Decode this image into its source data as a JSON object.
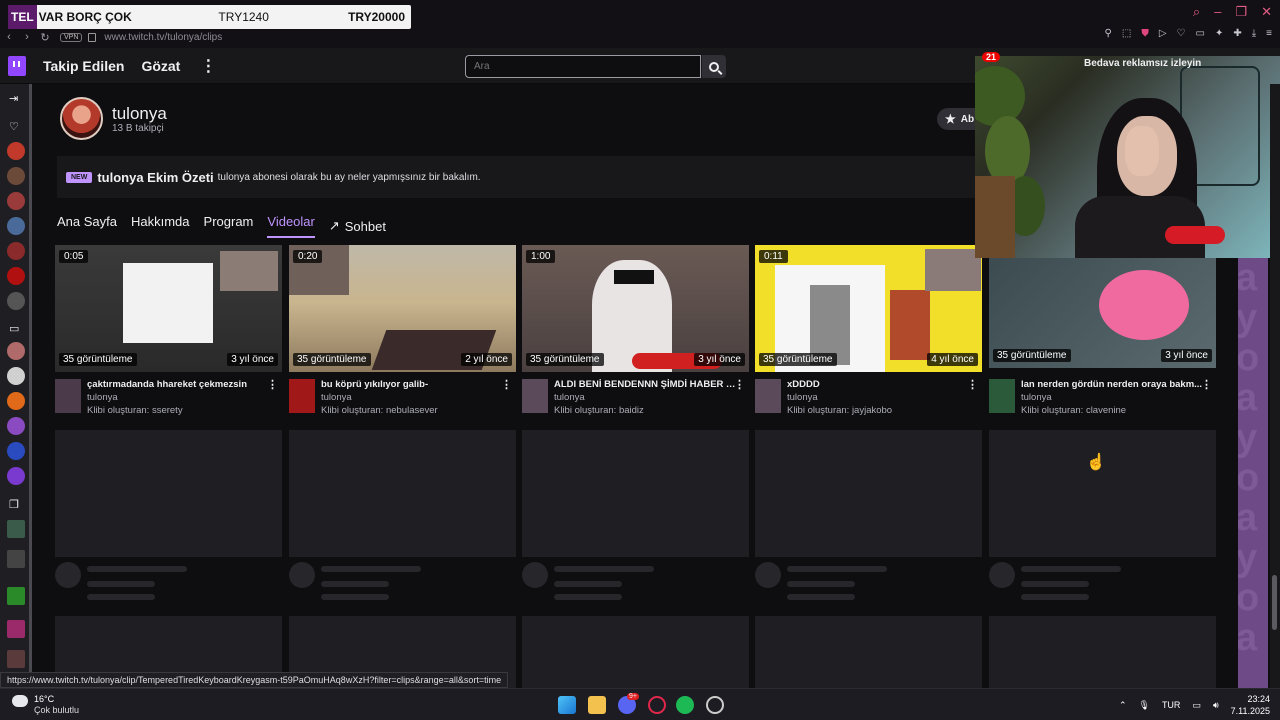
{
  "overlay_banner": {
    "tag": "TEL",
    "text": "VAR BORÇ ÇOK",
    "amount1": "TRY1240",
    "amount2": "TRY20000"
  },
  "browser": {
    "vpn": "VPN",
    "url": "www.twitch.tv/tulonya/clips"
  },
  "topnav": {
    "following": "Takip Edilen",
    "browse": "Gözat",
    "more": "⋮",
    "search_placeholder": "Ara",
    "notif_count": "21",
    "adfree": "Bedava reklamsız izleyin"
  },
  "channel": {
    "name": "tulonya",
    "followers": "13 B takipçi",
    "subscribe": "Ab"
  },
  "recap": {
    "badge": "NEW",
    "title": "tulonya Ekim Özeti",
    "desc": "tulonya abonesi olarak bu ay neler yapmışsınız bir bakalım."
  },
  "tabs": {
    "home": "Ana Sayfa",
    "about": "Hakkımda",
    "schedule": "Program",
    "videos": "Videolar",
    "chat": "Sohbet"
  },
  "clips": [
    {
      "duration": "0:05",
      "views": "35 görüntüleme",
      "ago": "3 yıl önce",
      "title": "çaktırmadanda hhareket çekmezsin",
      "channel": "tulonya",
      "clipper": "Klibi oluşturan: sserety"
    },
    {
      "duration": "0:20",
      "views": "35 görüntüleme",
      "ago": "2 yıl önce",
      "title": "bu köprü yıkılıyor galib-",
      "channel": "tulonya",
      "clipper": "Klibi oluşturan: nebulasever"
    },
    {
      "duration": "1:00",
      "views": "35 görüntüleme",
      "ago": "3 yıl önce",
      "title": "ALDI BENİ BENDENNN ŞİMDİ HABER Y...",
      "channel": "tulonya",
      "clipper": "Klibi oluşturan: baidiz"
    },
    {
      "duration": "0:11",
      "views": "35 görüntüleme",
      "ago": "4 yıl önce",
      "title": "xDDDD",
      "channel": "tulonya",
      "clipper": "Klibi oluşturan: jayjakobo"
    },
    {
      "duration": "",
      "views": "35 görüntüleme",
      "ago": "3 yıl önce",
      "title": "lan nerden gördün nerden oraya bakm...",
      "channel": "tulonya",
      "clipper": "Klibi oluşturan: clavenine"
    }
  ],
  "status_url": "https://www.twitch.tv/tulonya/clip/TemperedTiredKeyboardKreygasm-t59PaOmuHAq8wXzH?filter=clips&range=all&sort=time",
  "taskbar": {
    "temp": "16°C",
    "weather": "Çok bulutlu",
    "lang": "TUR",
    "time": "23:24",
    "date": "7.11.2025",
    "discord_badge": "9+"
  },
  "colors": {
    "accent": "#bf94ff",
    "twitch": "#9146ff",
    "background": "#0e0e10"
  }
}
